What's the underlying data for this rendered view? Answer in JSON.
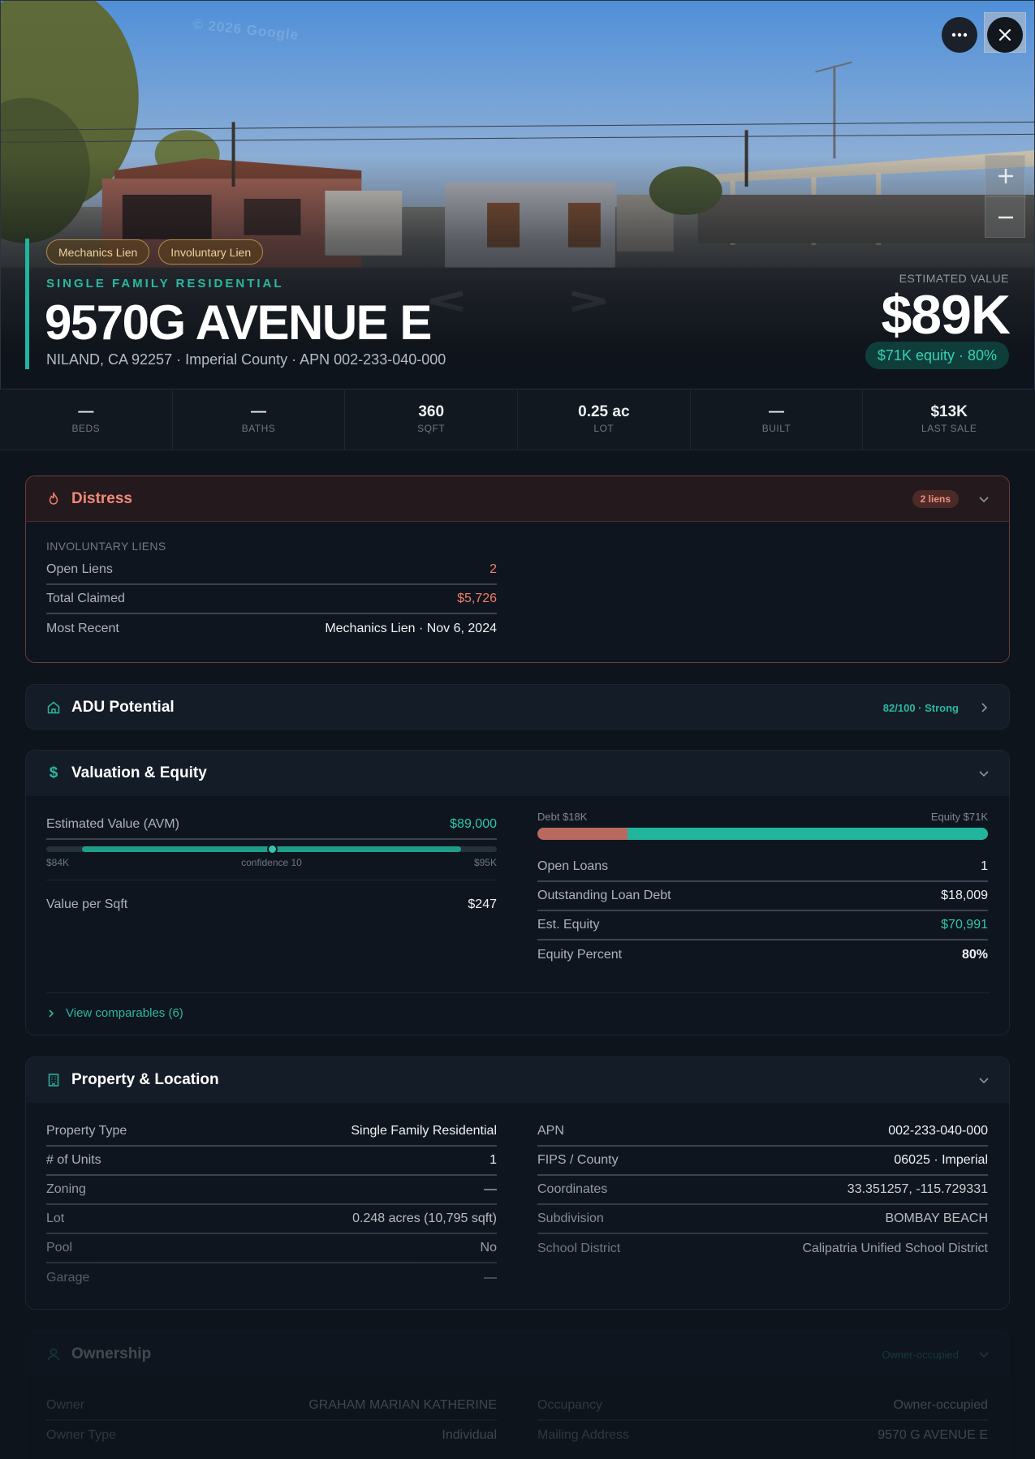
{
  "hero": {
    "watermark": "© 2026 Google",
    "tags": [
      "Mechanics Lien",
      "Involuntary Lien"
    ],
    "property_type": "SINGLE FAMILY RESIDENTIAL",
    "address": "9570G AVENUE E",
    "subaddress": "NILAND, CA 92257 · Imperial County · APN 002-233-040-000",
    "estimated_label": "ESTIMATED VALUE",
    "estimated_value": "$89K",
    "equity_pill": "$71K equity · 80%",
    "icons": {
      "more": "more-horizontal-icon",
      "close": "close-icon",
      "zoom_in": "plus-icon",
      "zoom_out": "minus-icon"
    }
  },
  "stats": [
    {
      "value": "—",
      "label": "BEDS"
    },
    {
      "value": "—",
      "label": "BATHS"
    },
    {
      "value": "360",
      "label": "SQFT"
    },
    {
      "value": "0.25 ac",
      "label": "LOT"
    },
    {
      "value": "—",
      "label": "BUILT"
    },
    {
      "value": "$13K",
      "label": "LAST SALE"
    }
  ],
  "distress": {
    "title": "Distress",
    "badge": "2 liens",
    "section": "INVOLUNTARY LIENS",
    "rows": [
      {
        "k": "Open Liens",
        "v": "2"
      },
      {
        "k": "Total Claimed",
        "v": "$5,726"
      },
      {
        "k": "Most Recent",
        "v": "Mechanics Lien · Nov 6, 2024"
      }
    ]
  },
  "adu": {
    "title": "ADU Potential",
    "score": "82/100 · Strong"
  },
  "valuation": {
    "title": "Valuation & Equity",
    "avm_label": "Estimated Value (AVM)",
    "avm_value": "$89,000",
    "range_low": "$84K",
    "range_mid": "confidence 10",
    "range_high": "$95K",
    "range_fill_start": 0.08,
    "range_fill_end": 0.92,
    "range_marker": 0.5,
    "per_sqft_label": "Value per Sqft",
    "per_sqft_value": "$247",
    "debt_label": "Debt $18K",
    "equity_label": "Equity $71K",
    "debt_fraction": 0.2,
    "rows": [
      {
        "k": "Open Loans",
        "v": "1"
      },
      {
        "k": "Outstanding Loan Debt",
        "v": "$18,009"
      },
      {
        "k": "Est. Equity",
        "v": "$70,991"
      },
      {
        "k": "Equity Percent",
        "v": "80%"
      }
    ],
    "comps_link": "View comparables (6)"
  },
  "property": {
    "title": "Property & Location",
    "left": [
      {
        "k": "Property Type",
        "v": "Single Family Residential"
      },
      {
        "k": "# of Units",
        "v": "1"
      },
      {
        "k": "Zoning",
        "v": "—"
      },
      {
        "k": "Lot",
        "v": "0.248 acres (10,795 sqft)"
      },
      {
        "k": "Pool",
        "v": "No"
      },
      {
        "k": "Garage",
        "v": "—"
      }
    ],
    "right": [
      {
        "k": "APN",
        "v": "002-233-040-000"
      },
      {
        "k": "FIPS / County",
        "v": "06025 · Imperial"
      },
      {
        "k": "Coordinates",
        "v": "33.351257, -115.729331"
      },
      {
        "k": "Subdivision",
        "v": "BOMBAY BEACH"
      },
      {
        "k": "School District",
        "v": "Calipatria Unified School District"
      }
    ]
  },
  "ownership": {
    "title": "Ownership",
    "badge": "Owner-occupied",
    "left": [
      {
        "k": "Owner",
        "v": "GRAHAM MARIAN KATHERINE"
      },
      {
        "k": "Owner Type",
        "v": "Individual"
      }
    ],
    "right": [
      {
        "k": "Occupancy",
        "v": "Owner-occupied"
      },
      {
        "k": "Mailing Address",
        "v": "9570 G AVENUE E"
      }
    ]
  },
  "colors": {
    "accent": "#1fb59f",
    "danger": "#ef7f6c",
    "background": "#0e141c",
    "card": "#141b25"
  }
}
